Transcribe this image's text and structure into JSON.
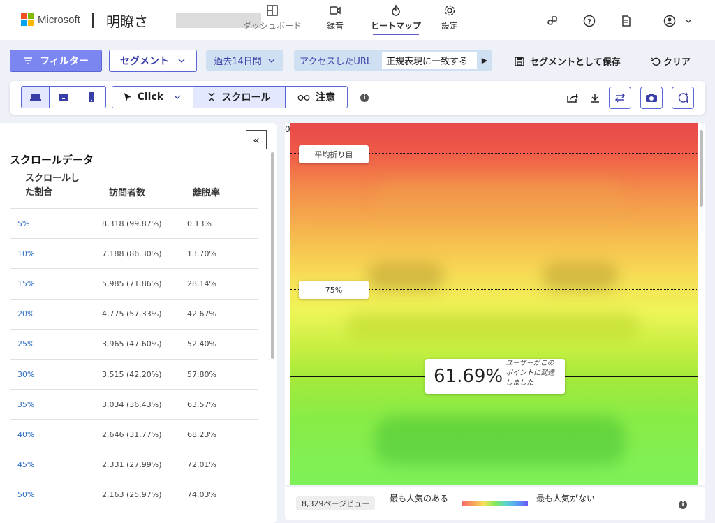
{
  "brand": {
    "company": "Microsoft",
    "product": "明瞭さ"
  },
  "nav": {
    "tabs": [
      {
        "label": "ダッシュボード",
        "icon": "dashboard-icon"
      },
      {
        "label": "録音",
        "icon": "video-camera-icon"
      },
      {
        "label": "ヒートマップ",
        "icon": "flame-icon",
        "active": true
      },
      {
        "label": "設定",
        "icon": "gear-icon"
      }
    ],
    "right_icons": [
      "users-icon",
      "help-icon",
      "document-icon",
      "account-icon"
    ]
  },
  "filters": {
    "filter_label": "フィルター",
    "segment_label": "セグメント",
    "period_label": "過去14日間",
    "url_label": "アクセスしたURL",
    "url_value": "正規表現に一致する",
    "save_segment_label": "セグメントとして保存",
    "clear_label": "クリア"
  },
  "toolbar": {
    "devices": [
      "desktop-icon",
      "tablet-icon",
      "mobile-icon"
    ],
    "modes": [
      {
        "label": "Click",
        "icon": "cursor-icon"
      },
      {
        "label": "スクロール",
        "icon": "scroll-icon",
        "active": true
      },
      {
        "label": "注意",
        "icon": "glasses-icon"
      }
    ],
    "info": "i"
  },
  "scroll_panel": {
    "title": "スクロールデータ",
    "columns": [
      "スクロールした割合",
      "訪問者数",
      "離脱率"
    ],
    "rows": [
      {
        "pct": "5%",
        "visitors": "8,318 (99.87%)",
        "drop": "0.13%"
      },
      {
        "pct": "10%",
        "visitors": "7,188 (86.30%)",
        "drop": "13.70%"
      },
      {
        "pct": "15%",
        "visitors": "5,985 (71.86%)",
        "drop": "28.14%"
      },
      {
        "pct": "20%",
        "visitors": "4,775 (57.33%)",
        "drop": "42.67%"
      },
      {
        "pct": "25%",
        "visitors": "3,965 (47.60%)",
        "drop": "52.40%"
      },
      {
        "pct": "30%",
        "visitors": "3,515 (42.20%)",
        "drop": "57.80%"
      },
      {
        "pct": "35%",
        "visitors": "3,034 (36.43%)",
        "drop": "63.57%"
      },
      {
        "pct": "40%",
        "visitors": "2,646 (31.77%)",
        "drop": "68.23%"
      },
      {
        "pct": "45%",
        "visitors": "2,331 (27.99%)",
        "drop": "72.01%"
      },
      {
        "pct": "50%",
        "visitors": "2,163 (25.97%)",
        "drop": "74.03%"
      }
    ]
  },
  "heatmap": {
    "zero_label": "0",
    "fold_label": "平均折り目",
    "p75_label": "75%",
    "reach_pct": "61.69%",
    "reach_text": "ユーザーがこのポイントに到達しました"
  },
  "legend": {
    "pageviews": "8,329ページビュー",
    "most": "最も人気のある",
    "least": "最も人気がない",
    "info": "i"
  }
}
